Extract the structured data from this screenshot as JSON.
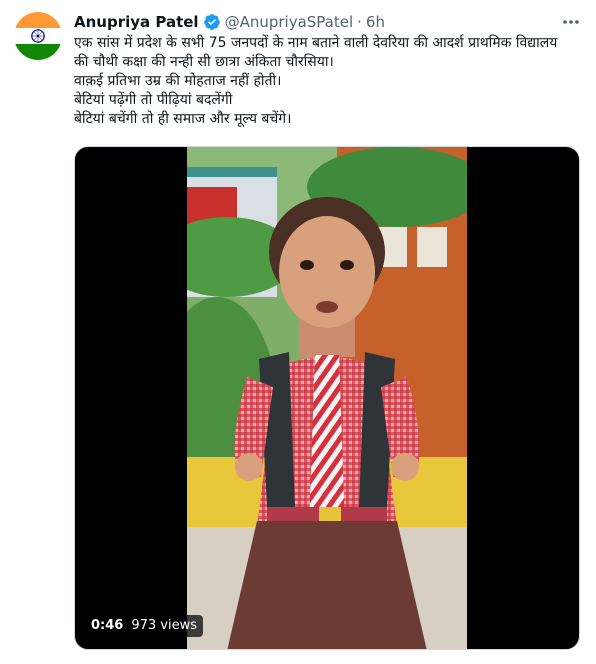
{
  "author": {
    "name": "Anupriya Patel",
    "handle": "@AnupriyaSPatel",
    "separator": "·",
    "time": "6h",
    "verified": true,
    "avatar_icon": "india-flag-avatar"
  },
  "tweet": {
    "lines": [
      "एक सांस में प्रदेश के सभी 75 जनपदों के नाम बताने वाली देवरिया की आदर्श प्राथमिक विद्यालय",
      "की चौथी कक्षा की नन्ही सी छात्रा अंकिता चौरसिया।",
      "वाक़ई प्रतिभा उम्र की मोहताज नहीं होती।",
      "बेटियां पढ़ेंगी तो पीढ़ियां बदलेंगी",
      "बेटियां बचेंगी तो ही समाज और मूल्य बचेंगे।"
    ]
  },
  "video": {
    "duration": "0:46",
    "views": "973 views"
  },
  "colors": {
    "text": "#0f1419",
    "secondary": "#536471",
    "verified": "#1d9bf0",
    "flag_saffron": "#ff9933",
    "flag_green": "#138808",
    "flag_chakra": "#000080"
  }
}
